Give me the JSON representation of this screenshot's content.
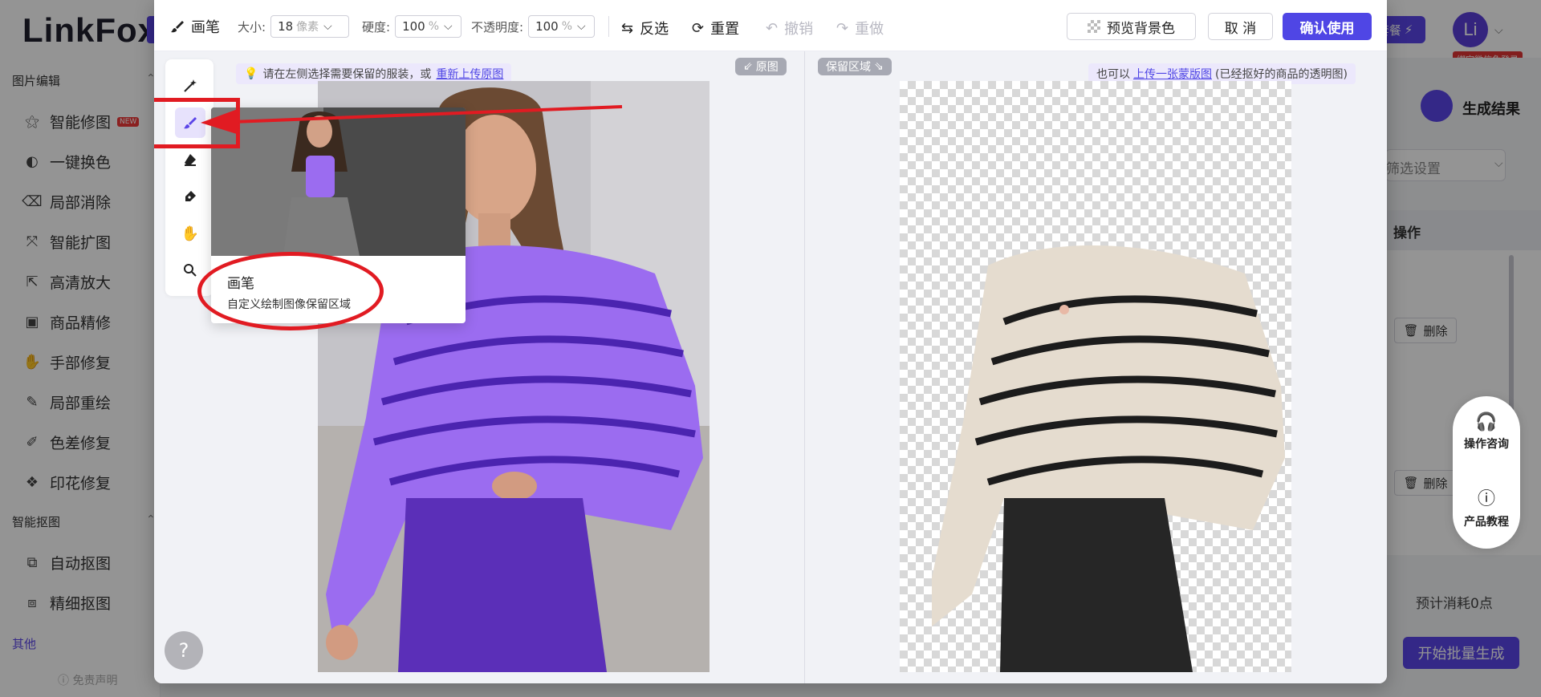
{
  "background_app": {
    "logo": "LinkFox",
    "plan_button": "套餐",
    "avatar_text": "Li",
    "bind_badge": "绑定微信免登录",
    "sidebar": {
      "section_image_edit": "图片编辑",
      "items_edit": [
        {
          "label": "智能修图",
          "icon": "magic-wand-icon",
          "badge": "NEW"
        },
        {
          "label": "一键换色",
          "icon": "color-swap-icon"
        },
        {
          "label": "局部消除",
          "icon": "eraser-icon"
        },
        {
          "label": "智能扩图",
          "icon": "expand-icon"
        },
        {
          "label": "高清放大",
          "icon": "upscale-icon"
        },
        {
          "label": "商品精修",
          "icon": "product-retouch-icon"
        },
        {
          "label": "手部修复",
          "icon": "hand-icon"
        },
        {
          "label": "局部重绘",
          "icon": "redraw-icon"
        },
        {
          "label": "色差修复",
          "icon": "color-fix-icon"
        },
        {
          "label": "印花修复",
          "icon": "pattern-icon"
        }
      ],
      "section_cutout": "智能抠图",
      "items_cutout": [
        {
          "label": "自动抠图",
          "icon": "auto-cutout-icon"
        },
        {
          "label": "精细抠图",
          "icon": "fine-cutout-icon"
        }
      ],
      "section_other": "其他",
      "disclaimer": "免责声明"
    },
    "right_panel": {
      "result_title": "生成结果",
      "filter_placeholder": "筛选设置",
      "operation_header": "操作",
      "delete_label": "删除",
      "cost_text": "预计消耗0点",
      "start_button": "开始批量生成"
    },
    "float_help": {
      "consult": "操作咨询",
      "tutorial": "产品教程"
    }
  },
  "modal": {
    "toolbar": {
      "brush_label": "画笔",
      "size_label": "大小:",
      "size_value": "18",
      "size_unit": "像素",
      "hardness_label": "硬度:",
      "hardness_value": "100",
      "hardness_unit": "%",
      "opacity_label": "不透明度:",
      "opacity_value": "100",
      "opacity_unit": "%",
      "invert_label": "反选",
      "reset_label": "重置",
      "undo_label": "撤销",
      "redo_label": "重做",
      "preview_bg_label": "预览背景色",
      "cancel_label": "取 消",
      "confirm_label": "确认使用"
    },
    "left_tip": {
      "text": "请在左侧选择需要保留的服装，或",
      "link": "重新上传原图"
    },
    "right_tip": {
      "prefix": "也可以",
      "link": "上传一张蒙版图",
      "suffix": "(已经抠好的商品的透明图)"
    },
    "original_tag": "原图",
    "keep_area_tag": "保留区域",
    "tools": [
      {
        "name": "magic-wand",
        "active": false
      },
      {
        "name": "brush",
        "active": true
      },
      {
        "name": "eraser",
        "active": false
      },
      {
        "name": "pen",
        "active": false
      },
      {
        "name": "hand",
        "active": false
      },
      {
        "name": "zoom",
        "active": false
      }
    ],
    "tooltip": {
      "title": "画笔",
      "description": "自定义绘制图像保留区域"
    },
    "help_glyph": "?"
  },
  "colors": {
    "accent": "#4f46e5",
    "annotation_red": "#e11b22",
    "sweater_purple": "#9b6cf0",
    "pants_purple": "#5b2fb8"
  }
}
